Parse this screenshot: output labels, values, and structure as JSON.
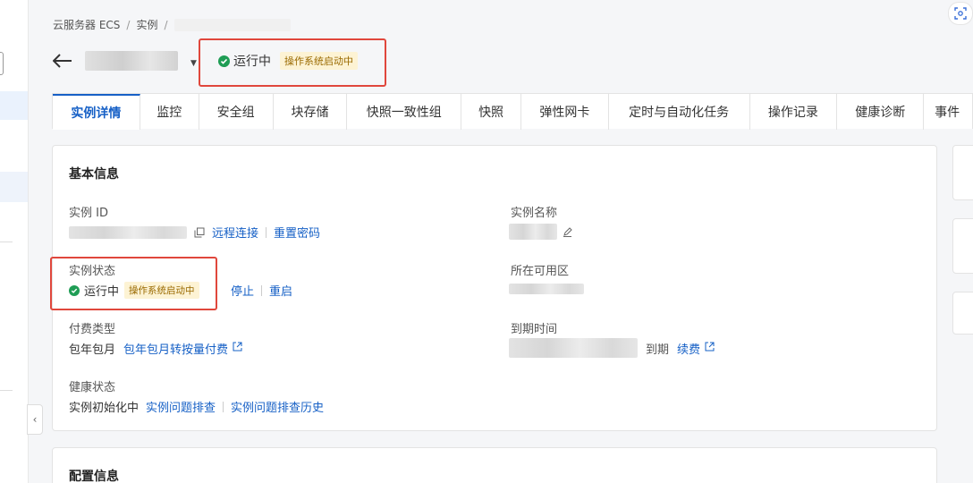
{
  "breadcrumb": {
    "root": "云服务器 ECS",
    "sep": "/",
    "instances": "实例"
  },
  "header": {
    "status_text": "运行中",
    "status_tag": "操作系统启动中"
  },
  "tabs": [
    {
      "label": "实例详情",
      "active": true
    },
    {
      "label": "监控"
    },
    {
      "label": "安全组"
    },
    {
      "label": "块存储"
    },
    {
      "label": "快照一致性组"
    },
    {
      "label": "快照"
    },
    {
      "label": "弹性网卡"
    },
    {
      "label": "定时与自动化任务"
    },
    {
      "label": "操作记录"
    },
    {
      "label": "健康诊断"
    },
    {
      "label": "事件"
    }
  ],
  "basic_info": {
    "title": "基本信息",
    "instance_id_label": "实例 ID",
    "remote_connect": "远程连接",
    "reset_password": "重置密码",
    "instance_name_label": "实例名称",
    "instance_status_label": "实例状态",
    "status_text": "运行中",
    "status_tag": "操作系统启动中",
    "stop": "停止",
    "restart": "重启",
    "zone_label": "所在可用区",
    "billing_label": "付费类型",
    "billing_value": "包年包月",
    "billing_convert": "包年包月转按量付费",
    "expire_label": "到期时间",
    "expire_suffix": "到期",
    "renew": "续费",
    "health_label": "健康状态",
    "health_value": "实例初始化中",
    "troubleshoot": "实例问题排查",
    "troubleshoot_history": "实例问题排查历史"
  },
  "config_info": {
    "title": "配置信息"
  },
  "colors": {
    "accent": "#1660c6",
    "success": "#1f9d55",
    "highlight_border": "#e0473c",
    "tag_bg": "#fdf3d4"
  }
}
